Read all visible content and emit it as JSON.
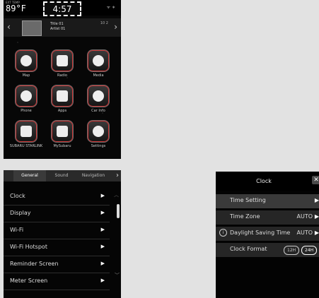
{
  "home": {
    "status": {
      "ext_label": "EXT TEMP",
      "temperature": "89°F",
      "time": "4:57",
      "signal": "ᯤ ∗"
    },
    "now_playing": {
      "title": "Title 01",
      "artist": "Artist 01",
      "track": "10 2"
    },
    "tiles": [
      {
        "label": "Map",
        "icon": "map-icon"
      },
      {
        "label": "Radio",
        "icon": "radio-icon"
      },
      {
        "label": "Media",
        "icon": "media-icon"
      },
      {
        "label": "Phone",
        "icon": "phone-icon"
      },
      {
        "label": "Apps",
        "icon": "apps-icon"
      },
      {
        "label": "Car Info",
        "icon": "car-info-icon"
      },
      {
        "label": "SUBARU STARLINK",
        "icon": "starlink-icon"
      },
      {
        "label": "MySubaru",
        "icon": "mysubaru-icon"
      },
      {
        "label": "Settings",
        "icon": "settings-icon"
      }
    ],
    "pages": {
      "count": 2,
      "active": 0
    }
  },
  "settings": {
    "tabs": [
      "General",
      "Sound",
      "Navigation"
    ],
    "selected_tab": "General",
    "items": [
      "Clock",
      "Display",
      "Wi-Fi",
      "Wi-Fi Hotspot",
      "Reminder Screen",
      "Meter Screen"
    ]
  },
  "clock_menu": {
    "title": "Clock",
    "close": "✕",
    "rows": [
      {
        "label": "Time Setting",
        "value": ""
      },
      {
        "label": "Time Zone",
        "value": "AUTO"
      },
      {
        "label": "Daylight Saving Time",
        "value": "AUTO"
      },
      {
        "label": "Clock Format",
        "value": ""
      }
    ],
    "format_options": [
      "12H",
      "24H"
    ],
    "format_selected": "24H"
  },
  "colors": {
    "accent_red": "#cc3333",
    "panel_dark": "#050505"
  }
}
